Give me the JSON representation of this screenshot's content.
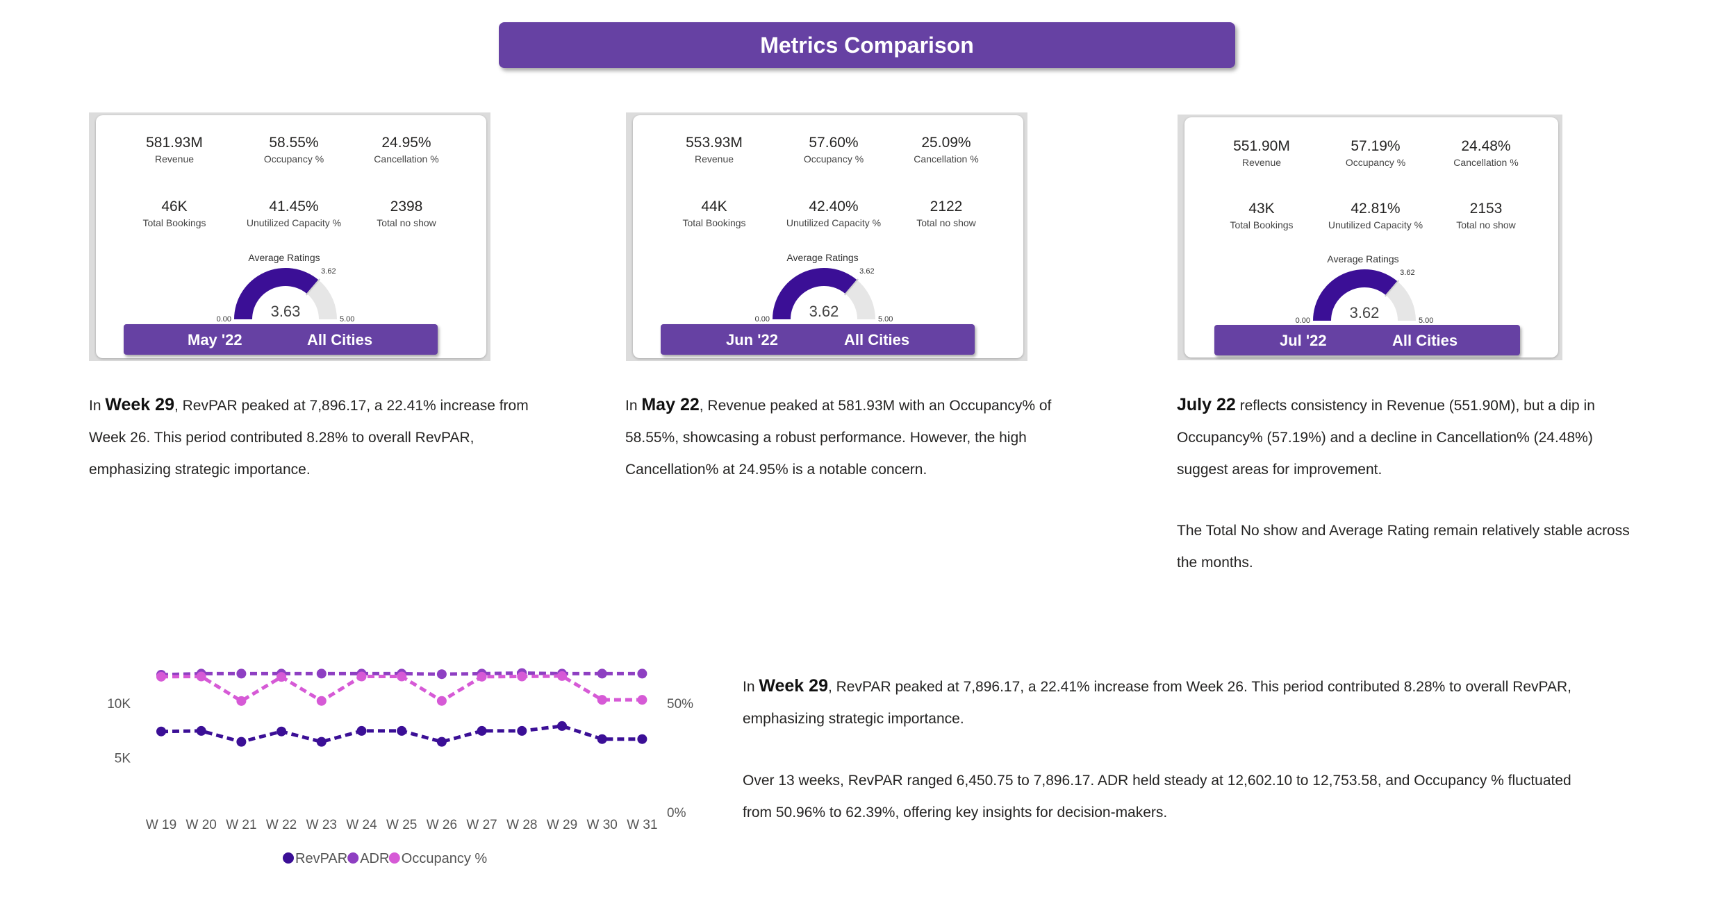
{
  "header": {
    "title": "Metrics Comparison"
  },
  "cards": [
    {
      "metrics": [
        {
          "value": "581.93M",
          "label": "Revenue"
        },
        {
          "value": "58.55%",
          "label": "Occupancy %"
        },
        {
          "value": "24.95%",
          "label": "Cancellation %"
        },
        {
          "value": "46K",
          "label": "Total Bookings"
        },
        {
          "value": "41.45%",
          "label": "Unutilized Capacity %"
        },
        {
          "value": "2398",
          "label": "Total no show"
        }
      ],
      "ratings_title": "Average Ratings",
      "rating_value": "3.63",
      "rating_target": "3.62",
      "gauge_min": "0.00",
      "gauge_max": "5.00",
      "month": "May '22",
      "city": "All Cities"
    },
    {
      "metrics": [
        {
          "value": "553.93M",
          "label": "Revenue"
        },
        {
          "value": "57.60%",
          "label": "Occupancy %"
        },
        {
          "value": "25.09%",
          "label": "Cancellation %"
        },
        {
          "value": "44K",
          "label": "Total Bookings"
        },
        {
          "value": "42.40%",
          "label": "Unutilized Capacity %"
        },
        {
          "value": "2122",
          "label": "Total no show"
        }
      ],
      "ratings_title": "Average Ratings",
      "rating_value": "3.62",
      "rating_target": "3.62",
      "gauge_min": "0.00",
      "gauge_max": "5.00",
      "month": "Jun '22",
      "city": "All Cities"
    },
    {
      "metrics": [
        {
          "value": "551.90M",
          "label": "Revenue"
        },
        {
          "value": "57.19%",
          "label": "Occupancy %"
        },
        {
          "value": "24.48%",
          "label": "Cancellation %"
        },
        {
          "value": "43K",
          "label": "Total Bookings"
        },
        {
          "value": "42.81%",
          "label": "Unutilized Capacity %"
        },
        {
          "value": "2153",
          "label": "Total no show"
        }
      ],
      "ratings_title": "Average Ratings",
      "rating_value": "3.62",
      "rating_target": "3.62",
      "gauge_min": "0.00",
      "gauge_max": "5.00",
      "month": "Jul '22",
      "city": "All Cities"
    }
  ],
  "texts": {
    "p1": {
      "pre": "In ",
      "bold": "Week 29",
      "post": ", RevPAR peaked at 7,896.17, a 22.41% increase from Week 26. This period contributed 8.28% to overall RevPAR, emphasizing strategic importance."
    },
    "p2": {
      "pre": "In ",
      "bold": "May 22",
      "post": ", Revenue peaked at 581.93M with an Occupancy% of 58.55%, showcasing a robust performance. However, the high Cancellation% at 24.95% is a notable concern."
    },
    "p3": {
      "pre": "",
      "bold": "July 22",
      "post": " reflects consistency in Revenue (551.90M), but a dip in Occupancy% (57.19%) and a decline in Cancellation% (24.48%) suggest areas for improvement."
    },
    "p3b": "The Total No show and Average Rating remain relatively stable across the months.",
    "p4": {
      "pre": "In ",
      "bold": "Week 29",
      "post": ", RevPAR peaked at 7,896.17, a 22.41% increase from Week 26. This period contributed 8.28% to overall RevPAR, emphasizing strategic importance."
    },
    "p5": "Over 13 weeks, RevPAR ranged 6,450.75 to 7,896.17. ADR held steady at 12,602.10 to 12,753.58, and Occupancy % fluctuated from 50.96% to 62.39%, offering key insights for decision-makers."
  },
  "colors": {
    "accent": "#6641a3",
    "revpar": "#3b0f96",
    "adr": "#8e3fc2",
    "occupancy": "#d65ad6",
    "gauge_fill": "#3b0f96",
    "gauge_track": "#e6e6e6"
  },
  "chart_data": {
    "type": "line",
    "categories": [
      "W 19",
      "W 20",
      "W 21",
      "W 22",
      "W 23",
      "W 24",
      "W 25",
      "W 26",
      "W 27",
      "W 28",
      "W 29",
      "W 30",
      "W 31"
    ],
    "y_left_ticks": [
      "10K",
      "5K"
    ],
    "y_right_ticks": [
      "50%",
      "0%"
    ],
    "y_left_range": [
      0,
      14000
    ],
    "y_right_range": [
      0,
      70
    ],
    "series": [
      {
        "name": "RevPAR",
        "axis": "left",
        "values": [
          7400,
          7450,
          6450,
          7400,
          6450,
          7450,
          7450,
          6450,
          7450,
          7450,
          7896,
          6700,
          6700
        ]
      },
      {
        "name": "ADR",
        "axis": "left",
        "values": [
          12602,
          12700,
          12700,
          12700,
          12700,
          12700,
          12700,
          12650,
          12700,
          12753,
          12700,
          12700,
          12700
        ]
      },
      {
        "name": "Occupancy %",
        "axis": "right",
        "values": [
          62.1,
          62.2,
          50.96,
          62.0,
          51.0,
          62.2,
          62.2,
          51.0,
          62.1,
          62.2,
          62.39,
          51.5,
          51.5
        ]
      }
    ],
    "legend": [
      "RevPAR",
      "ADR",
      "Occupancy %"
    ],
    "legend_position": "bottom",
    "grid": false
  }
}
